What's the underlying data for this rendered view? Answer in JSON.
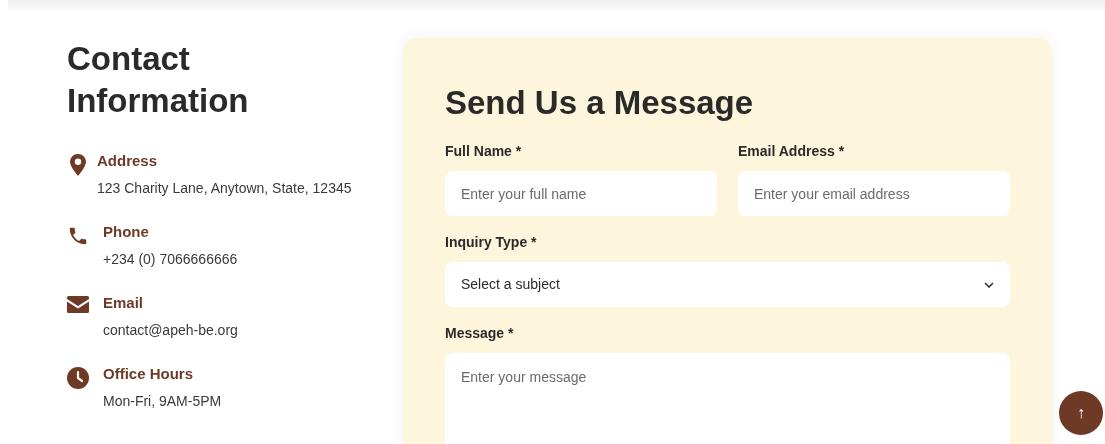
{
  "contact": {
    "title": "Contact Information",
    "items": [
      {
        "kind": "pin",
        "label": "Address",
        "value": "123 Charity Lane, Anytown, State, 12345"
      },
      {
        "kind": "phone",
        "label": "Phone",
        "value": "+234 (0) 7066666666"
      },
      {
        "kind": "mail",
        "label": "Email",
        "value": "contact@apeh-be.org"
      },
      {
        "kind": "clock",
        "label": "Office Hours",
        "value": "Mon-Fri, 9AM-5PM"
      }
    ]
  },
  "form": {
    "title": "Send Us a Message",
    "fields": [
      {
        "kind": "input",
        "label": "Full Name *",
        "placeholder": "Enter your full name"
      },
      {
        "kind": "input",
        "label": "Email Address *",
        "placeholder": "Enter your email address"
      },
      {
        "kind": "select",
        "label": "Inquiry Type *",
        "value": "Select a subject"
      },
      {
        "kind": "textarea",
        "label": "Message *",
        "placeholder": "Enter your message"
      }
    ]
  },
  "scroll_top_button": {
    "label": "↑"
  }
}
